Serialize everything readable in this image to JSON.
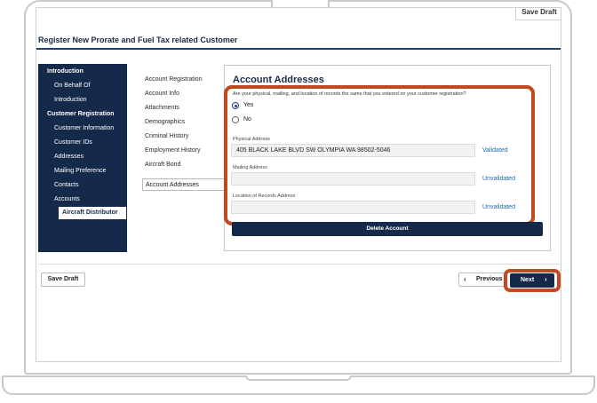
{
  "header": {
    "top_save_label": "Save Draft",
    "page_title": "Register New Prorate and Fuel Tax related Customer"
  },
  "left_nav": {
    "items": [
      {
        "label": "Introduction",
        "type": "heading"
      },
      {
        "label": "On Behalf Of",
        "type": "item"
      },
      {
        "label": "Introduction",
        "type": "item"
      },
      {
        "label": "Customer Registration",
        "type": "heading"
      },
      {
        "label": "Customer Information",
        "type": "item"
      },
      {
        "label": "Customer IDs",
        "type": "item"
      },
      {
        "label": "Addresses",
        "type": "item"
      },
      {
        "label": "Mailing Preference",
        "type": "item"
      },
      {
        "label": "Contacts",
        "type": "item"
      },
      {
        "label": "Accounts",
        "type": "item"
      },
      {
        "label": "Aircraft Distributor",
        "type": "selected"
      }
    ]
  },
  "sub_nav": {
    "items": [
      "Account Registration",
      "Account Info",
      "Attachments",
      "Demographics",
      "Criminal History",
      "Employment History",
      "Aircraft Bond",
      "Account Addresses"
    ],
    "active": "Account Addresses"
  },
  "panel": {
    "title": "Account Addresses",
    "question": "Are your physical, mailing, and location of records the same that you entered on your customer registration?",
    "options": [
      {
        "label": "Yes",
        "selected": true
      },
      {
        "label": "No",
        "selected": false
      }
    ],
    "fields": [
      {
        "label": "Physical Address",
        "value": "405 BLACK LAKE BLVD SW OLYMPIA WA 98502-5046",
        "status": "Validated"
      },
      {
        "label": "Mailing Address",
        "value": "",
        "status": "Unvalidated"
      },
      {
        "label": "Location of Records Address",
        "value": "",
        "status": "Unvalidated"
      }
    ],
    "delete_label": "Delete Account"
  },
  "footer": {
    "save_draft_label": "Save Draft",
    "previous_label": "Previous",
    "next_label": "Next"
  },
  "colors": {
    "navy": "#152a4a",
    "highlight": "#c0491f",
    "link": "#2168b6"
  },
  "icons": {
    "previous": "chevron-left-icon",
    "next": "chevron-right-icon"
  }
}
